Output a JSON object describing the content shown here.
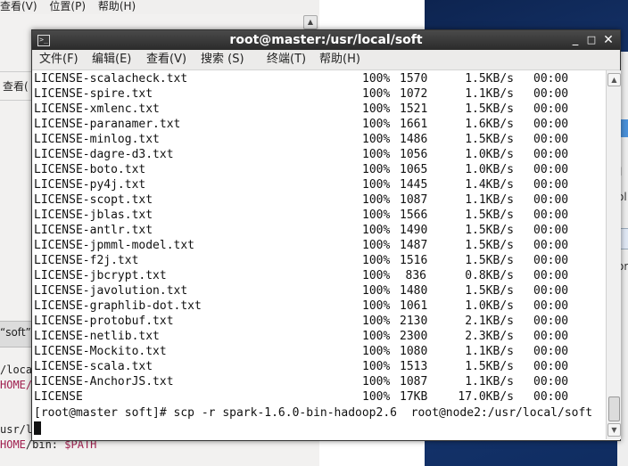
{
  "background_window": {
    "menubar": [
      "查看(V)",
      "位置(P)",
      "帮助(H)"
    ],
    "view_label": "查看(",
    "soft_label": "“soft”",
    "code_lines": [
      {
        "prefix": "/loca",
        "highlight": ""
      },
      {
        "prefix": "",
        "highlight": "HOME/b"
      },
      {
        "prefix": "usr/l/",
        "highlight": ""
      },
      {
        "prefix": "",
        "highlight": "HOME",
        "rest": "/bin: ",
        "var": "$PATH"
      }
    ]
  },
  "right_fragments": [
    "l",
    "ol",
    "or"
  ],
  "terminal": {
    "title": "root@master:/usr/local/soft",
    "menu": [
      "文件(F)",
      "编辑(E)",
      "查看(V)",
      "搜索 (S)",
      "终端(T)",
      "帮助(H)"
    ],
    "transfers": [
      {
        "name": "LICENSE-scalacheck.txt",
        "pct": "100%",
        "size": "1570",
        "rate": "1.5KB/s",
        "eta": "00:00"
      },
      {
        "name": "LICENSE-spire.txt",
        "pct": "100%",
        "size": "1072",
        "rate": "1.1KB/s",
        "eta": "00:00"
      },
      {
        "name": "LICENSE-xmlenc.txt",
        "pct": "100%",
        "size": "1521",
        "rate": "1.5KB/s",
        "eta": "00:00"
      },
      {
        "name": "LICENSE-paranamer.txt",
        "pct": "100%",
        "size": "1661",
        "rate": "1.6KB/s",
        "eta": "00:00"
      },
      {
        "name": "LICENSE-minlog.txt",
        "pct": "100%",
        "size": "1486",
        "rate": "1.5KB/s",
        "eta": "00:00"
      },
      {
        "name": "LICENSE-dagre-d3.txt",
        "pct": "100%",
        "size": "1056",
        "rate": "1.0KB/s",
        "eta": "00:00"
      },
      {
        "name": "LICENSE-boto.txt",
        "pct": "100%",
        "size": "1065",
        "rate": "1.0KB/s",
        "eta": "00:00"
      },
      {
        "name": "LICENSE-py4j.txt",
        "pct": "100%",
        "size": "1445",
        "rate": "1.4KB/s",
        "eta": "00:00"
      },
      {
        "name": "LICENSE-scopt.txt",
        "pct": "100%",
        "size": "1087",
        "rate": "1.1KB/s",
        "eta": "00:00"
      },
      {
        "name": "LICENSE-jblas.txt",
        "pct": "100%",
        "size": "1566",
        "rate": "1.5KB/s",
        "eta": "00:00"
      },
      {
        "name": "LICENSE-antlr.txt",
        "pct": "100%",
        "size": "1490",
        "rate": "1.5KB/s",
        "eta": "00:00"
      },
      {
        "name": "LICENSE-jpmml-model.txt",
        "pct": "100%",
        "size": "1487",
        "rate": "1.5KB/s",
        "eta": "00:00"
      },
      {
        "name": "LICENSE-f2j.txt",
        "pct": "100%",
        "size": "1516",
        "rate": "1.5KB/s",
        "eta": "00:00"
      },
      {
        "name": "LICENSE-jbcrypt.txt",
        "pct": "100%",
        "size": "836",
        "rate": "0.8KB/s",
        "eta": "00:00"
      },
      {
        "name": "LICENSE-javolution.txt",
        "pct": "100%",
        "size": "1480",
        "rate": "1.5KB/s",
        "eta": "00:00"
      },
      {
        "name": "LICENSE-graphlib-dot.txt",
        "pct": "100%",
        "size": "1061",
        "rate": "1.0KB/s",
        "eta": "00:00"
      },
      {
        "name": "LICENSE-protobuf.txt",
        "pct": "100%",
        "size": "2130",
        "rate": "2.1KB/s",
        "eta": "00:00"
      },
      {
        "name": "LICENSE-netlib.txt",
        "pct": "100%",
        "size": "2300",
        "rate": "2.3KB/s",
        "eta": "00:00"
      },
      {
        "name": "LICENSE-Mockito.txt",
        "pct": "100%",
        "size": "1080",
        "rate": "1.1KB/s",
        "eta": "00:00"
      },
      {
        "name": "LICENSE-scala.txt",
        "pct": "100%",
        "size": "1513",
        "rate": "1.5KB/s",
        "eta": "00:00"
      },
      {
        "name": "LICENSE-AnchorJS.txt",
        "pct": "100%",
        "size": "1087",
        "rate": "1.1KB/s",
        "eta": "00:00"
      },
      {
        "name": "LICENSE",
        "pct": "100%",
        "size": "17KB",
        "rate": "17.0KB/s",
        "eta": "00:00"
      }
    ],
    "prompt": "[root@master soft]# scp -r spark-1.6.0-bin-hadoop2.6  root@node2:/usr/local/soft"
  }
}
